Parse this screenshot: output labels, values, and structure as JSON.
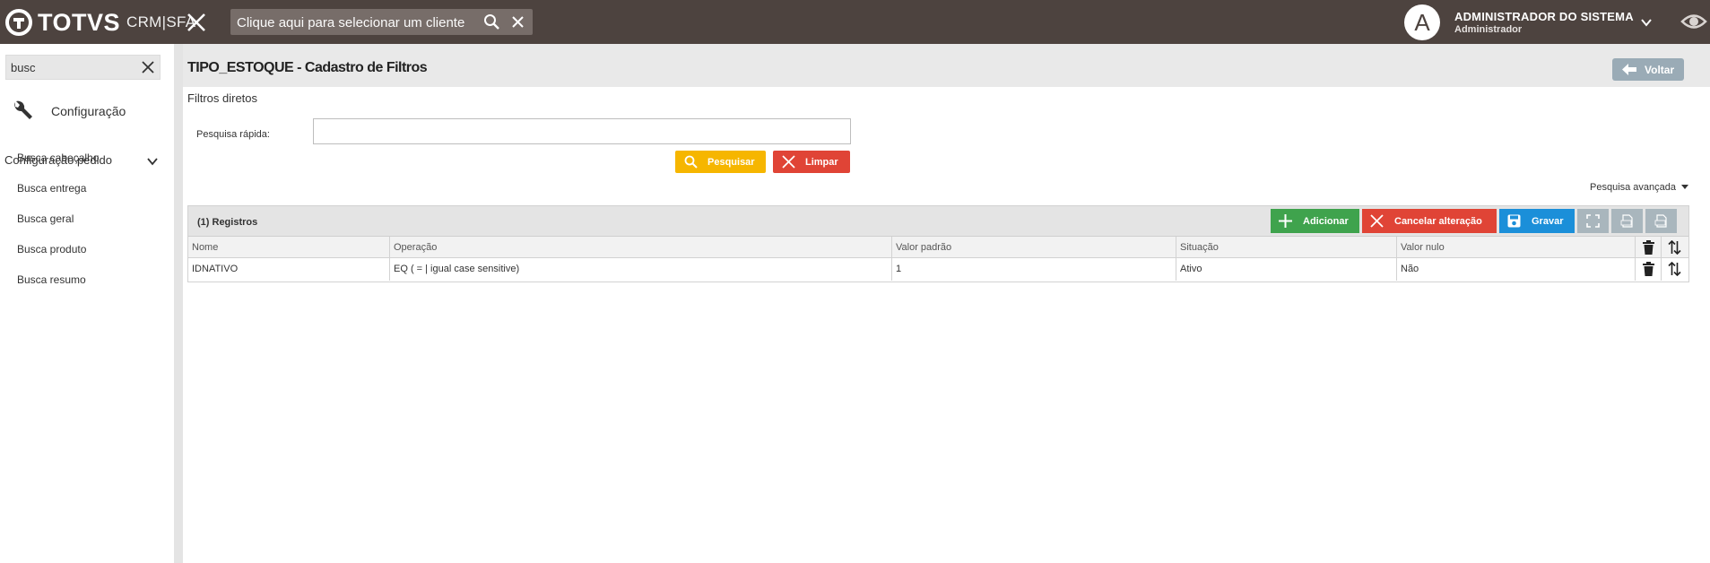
{
  "header": {
    "brand": "TOTVS",
    "product": "CRM|SFA",
    "client_search_placeholder": "Clique aqui para selecionar um cliente",
    "user_initial": "A",
    "user_name": "ADMINISTRADOR DO SISTEMA",
    "user_role": "Administrador"
  },
  "sidebar": {
    "search_value": "busc",
    "section": "Configuração",
    "group": "Configuração pedido",
    "items": [
      {
        "label": "Busca cabeçalho"
      },
      {
        "label": "Busca entrega"
      },
      {
        "label": "Busca geral"
      },
      {
        "label": "Busca produto"
      },
      {
        "label": "Busca resumo"
      }
    ]
  },
  "page": {
    "title": "TIPO_ESTOQUE - Cadastro de Filtros",
    "back_label": "Voltar",
    "filters_heading": "Filtros diretos",
    "quick_search_label": "Pesquisa rápida:",
    "quick_search_value": "",
    "search_button": "Pesquisar",
    "clear_button": "Limpar",
    "advanced_search": "Pesquisa avançada"
  },
  "grid": {
    "count_label": "(1) Registros",
    "add_button": "Adicionar",
    "cancel_button": "Cancelar alteração",
    "save_button": "Gravar",
    "columns": [
      "Nome",
      "Operação",
      "Valor padrão",
      "Situação",
      "Valor nulo"
    ],
    "rows": [
      {
        "nome": "IDNATIVO",
        "operacao": "EQ ( = | igual case sensitive)",
        "valor_padrao": "1",
        "situacao": "Ativo",
        "valor_nulo": "Não"
      }
    ]
  },
  "colors": {
    "topbar": "#4d433f",
    "search_button": "#f6b600",
    "clear_button": "#e04436",
    "add_button": "#3fa34d",
    "cancel_button": "#e04436",
    "save_button": "#1b8fd9",
    "back_button": "#9aabb6"
  }
}
